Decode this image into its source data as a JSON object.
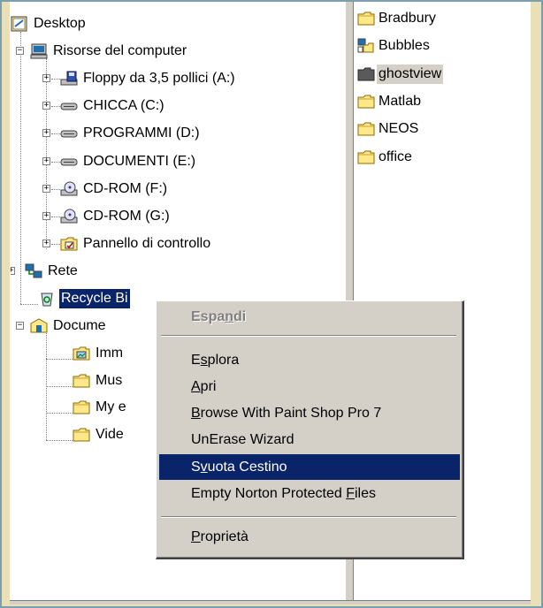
{
  "tree": {
    "items": [
      {
        "label": "Desktop",
        "icon": "desktop-icon"
      },
      {
        "label": "Risorse del computer",
        "icon": "computer-icon"
      },
      {
        "label": "Floppy da 3,5 pollici (A:)",
        "icon": "floppy-drive-icon"
      },
      {
        "label": "CHICCA (C:)",
        "icon": "hard-drive-icon"
      },
      {
        "label": "PROGRAMMI (D:)",
        "icon": "hard-drive-icon"
      },
      {
        "label": "DOCUMENTI (E:)",
        "icon": "hard-drive-icon"
      },
      {
        "label": "CD-ROM (F:)",
        "icon": "cdrom-drive-icon"
      },
      {
        "label": "CD-ROM (G:)",
        "icon": "cdrom-drive-icon"
      },
      {
        "label": "Pannello di controllo",
        "icon": "control-panel-icon"
      },
      {
        "label": "Rete",
        "icon": "network-icon"
      },
      {
        "label": "Recycle Bi",
        "icon": "recycle-bin-icon"
      },
      {
        "label": "Docume",
        "icon": "documents-folder-icon"
      },
      {
        "label": "Imm",
        "icon": "pictures-folder-icon"
      },
      {
        "label": "Mus",
        "icon": "folder-icon"
      },
      {
        "label": "My e",
        "icon": "folder-icon"
      },
      {
        "label": "Vide",
        "icon": "folder-icon"
      }
    ]
  },
  "files": {
    "items": [
      {
        "label": "Bradbury",
        "icon": "folder-icon"
      },
      {
        "label": "Bubbles",
        "icon": "shortcut-folder-icon"
      },
      {
        "label": "ghostview",
        "icon": "folder-icon"
      },
      {
        "label": "Matlab",
        "icon": "folder-icon"
      },
      {
        "label": "NEOS",
        "icon": "folder-icon"
      },
      {
        "label": "office",
        "icon": "folder-icon"
      }
    ]
  },
  "context_menu": {
    "espandi": {
      "pre": "Espa",
      "key": "n",
      "post": "di"
    },
    "esplora": {
      "pre": "E",
      "key": "s",
      "post": "plora"
    },
    "apri": {
      "pre": "",
      "key": "A",
      "post": "pri"
    },
    "browse": {
      "pre": "",
      "key": "B",
      "post": "rowse With Paint Shop Pro 7"
    },
    "unerase": {
      "pre": "UnErase Wizard",
      "key": "",
      "post": ""
    },
    "svuota": {
      "pre": "S",
      "key": "v",
      "post": "uota Cestino"
    },
    "empty_norton": {
      "pre": "Empty Norton Protected ",
      "key": "F",
      "post": "iles"
    },
    "proprieta": {
      "pre": "",
      "key": "P",
      "post": "roprietà"
    }
  },
  "colors": {
    "selection": "#0a246a",
    "menu_background": "#d4d0c8",
    "desktop_background": "#e9dfb9",
    "folder_yellow": "#ffe88a"
  }
}
